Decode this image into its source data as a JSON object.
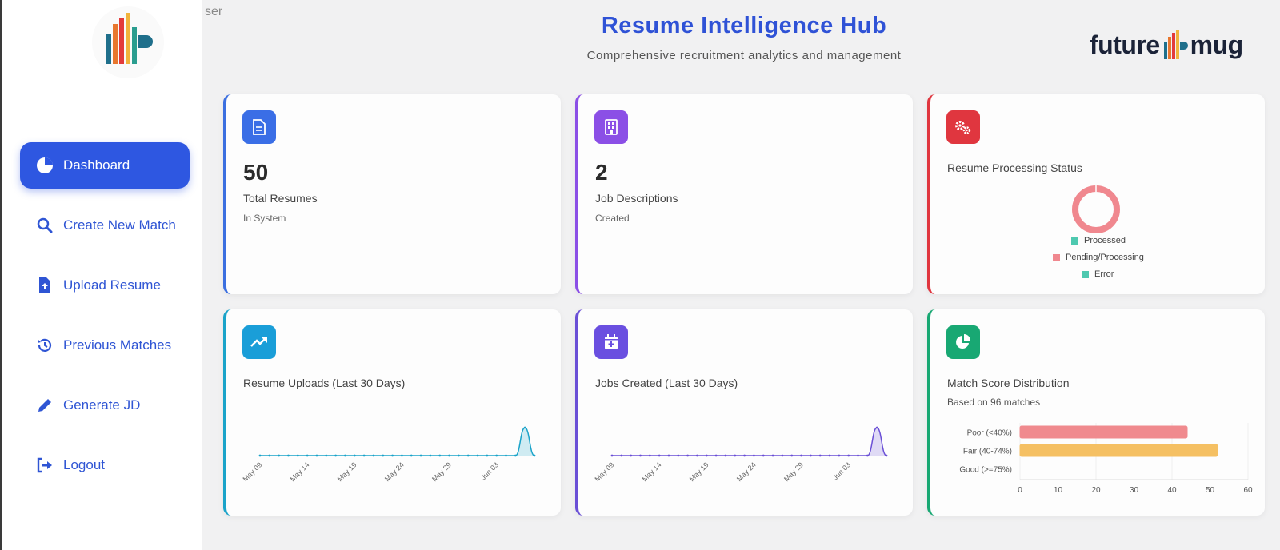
{
  "sidebar": {
    "user_fragment": "ser",
    "items": [
      {
        "label": "Dashboard",
        "icon": "pie-chart-icon",
        "active": true
      },
      {
        "label": "Create New Match",
        "icon": "search-icon"
      },
      {
        "label": "Upload Resume",
        "icon": "upload-file-icon"
      },
      {
        "label": "Previous Matches",
        "icon": "history-icon"
      },
      {
        "label": "Generate JD",
        "icon": "pencil-icon"
      },
      {
        "label": "Logout",
        "icon": "logout-icon"
      }
    ]
  },
  "header": {
    "title": "Resume Intelligence Hub",
    "subtitle": "Comprehensive recruitment analytics and management",
    "brand_left": "future",
    "brand_right": "mug"
  },
  "cards": {
    "total_resumes": {
      "value": "50",
      "label": "Total Resumes",
      "sub": "In System",
      "accent": "#3b6fe0"
    },
    "job_descriptions": {
      "value": "2",
      "label": "Job Descriptions",
      "sub": "Created",
      "accent": "#8b4fe6"
    },
    "processing": {
      "title": "Resume Processing Status",
      "accent": "#e0363f",
      "legend": [
        "Processed",
        "Pending/Processing",
        "Error"
      ]
    },
    "uploads": {
      "title": "Resume Uploads (Last 30 Days)",
      "accent": "#1aa3c9"
    },
    "jobs_created": {
      "title": "Jobs Created (Last 30 Days)",
      "accent": "#6a4fd6"
    },
    "match_scores": {
      "title": "Match Score Distribution",
      "sub": "Based on 96 matches",
      "accent": "#18a873"
    }
  },
  "chart_data": [
    {
      "type": "pie",
      "title": "Resume Processing Status",
      "categories": [
        "Processed",
        "Pending/Processing",
        "Error"
      ],
      "values": [
        0,
        50,
        0
      ],
      "colors": [
        "#4ec9b0",
        "#f0888f",
        "#4ec9b0"
      ]
    },
    {
      "type": "area",
      "title": "Resume Uploads (Last 30 Days)",
      "x": [
        "May 09",
        "May 10",
        "May 11",
        "May 12",
        "May 13",
        "May 14",
        "May 15",
        "May 16",
        "May 17",
        "May 18",
        "May 19",
        "May 20",
        "May 21",
        "May 22",
        "May 23",
        "May 24",
        "May 25",
        "May 26",
        "May 27",
        "May 28",
        "May 29",
        "May 30",
        "May 31",
        "Jun 01",
        "Jun 02",
        "Jun 03",
        "Jun 04",
        "Jun 05",
        "Jun 06",
        "Jun 07"
      ],
      "values": [
        0,
        0,
        0,
        0,
        0,
        0,
        0,
        0,
        0,
        0,
        0,
        0,
        0,
        0,
        0,
        0,
        0,
        0,
        0,
        0,
        0,
        0,
        0,
        0,
        0,
        0,
        0,
        0,
        50,
        0
      ],
      "tick_labels": [
        "May 09",
        "May 14",
        "May 19",
        "May 24",
        "May 29",
        "Jun 03"
      ],
      "color": "#1aa3c9"
    },
    {
      "type": "area",
      "title": "Jobs Created (Last 30 Days)",
      "x": [
        "May 09",
        "May 10",
        "May 11",
        "May 12",
        "May 13",
        "May 14",
        "May 15",
        "May 16",
        "May 17",
        "May 18",
        "May 19",
        "May 20",
        "May 21",
        "May 22",
        "May 23",
        "May 24",
        "May 25",
        "May 26",
        "May 27",
        "May 28",
        "May 29",
        "May 30",
        "May 31",
        "Jun 01",
        "Jun 02",
        "Jun 03",
        "Jun 04",
        "Jun 05",
        "Jun 06",
        "Jun 07"
      ],
      "values": [
        0,
        0,
        0,
        0,
        0,
        0,
        0,
        0,
        0,
        0,
        0,
        0,
        0,
        0,
        0,
        0,
        0,
        0,
        0,
        0,
        0,
        0,
        0,
        0,
        0,
        0,
        0,
        0,
        2,
        0
      ],
      "tick_labels": [
        "May 09",
        "May 14",
        "May 19",
        "May 24",
        "May 29",
        "Jun 03"
      ],
      "color": "#6a4fd6"
    },
    {
      "type": "bar",
      "orientation": "horizontal",
      "title": "Match Score Distribution",
      "categories": [
        "Poor (<40%)",
        "Fair (40-74%)",
        "Good (>=75%)"
      ],
      "values": [
        44,
        52,
        0
      ],
      "colors": [
        "#f08a8e",
        "#f5c063",
        "#6fd0a6"
      ],
      "xlim": [
        0,
        60
      ],
      "xticks": [
        0,
        10,
        20,
        30,
        40,
        50,
        60
      ]
    }
  ]
}
